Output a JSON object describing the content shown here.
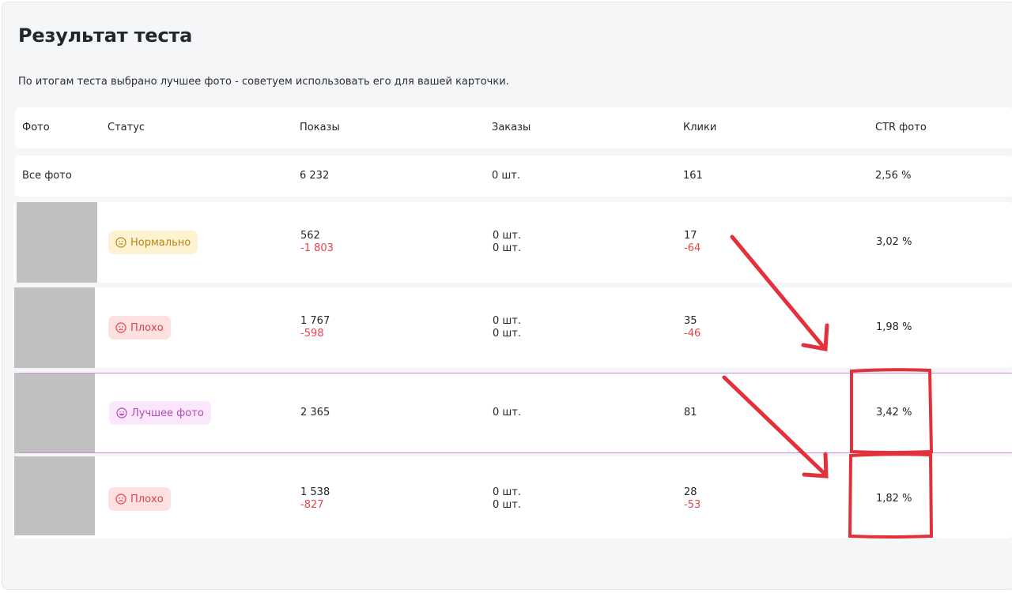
{
  "page": {
    "title": "Результат теста",
    "subtitle": "По итогам теста выбрано лучшее фото - советуем использовать его для вашей карточки."
  },
  "columns": {
    "photo": "Фото",
    "status": "Статус",
    "views": "Показы",
    "orders": "Заказы",
    "clicks": "Клики",
    "ctr": "CTR фото"
  },
  "summary": {
    "label": "Все фото",
    "views": "6 232",
    "orders": "0 шт.",
    "clicks": "161",
    "ctr": "2,56 %"
  },
  "rows": [
    {
      "status": "Нормально",
      "status_icon": "neutral-face-icon",
      "views": "562",
      "views_delta": "-1 803",
      "orders": "0 шт.",
      "orders_delta": "0 шт.",
      "clicks": "17",
      "clicks_delta": "-64",
      "ctr": "3,02 %"
    },
    {
      "status": "Плохо",
      "status_icon": "sad-face-icon",
      "views": "1 767",
      "views_delta": "-598",
      "orders": "0 шт.",
      "orders_delta": "0 шт.",
      "clicks": "35",
      "clicks_delta": "-46",
      "ctr": "1,98 %"
    },
    {
      "status": "Лучшее фото",
      "status_icon": "happy-face-icon",
      "views": "2 365",
      "orders": "0 шт.",
      "clicks": "81",
      "ctr": "3,42 %"
    },
    {
      "status": "Плохо",
      "status_icon": "sad-face-icon",
      "views": "1 538",
      "views_delta": "-827",
      "orders": "0 шт.",
      "orders_delta": "0 шт.",
      "clicks": "28",
      "clicks_delta": "-53",
      "ctr": "1,82 %"
    }
  ],
  "colors": {
    "background": "#f5f6f8",
    "card": "#ffffff",
    "negative": "#e8424b",
    "annotation": "#e3303a",
    "best_highlight": "#c98fd6"
  }
}
